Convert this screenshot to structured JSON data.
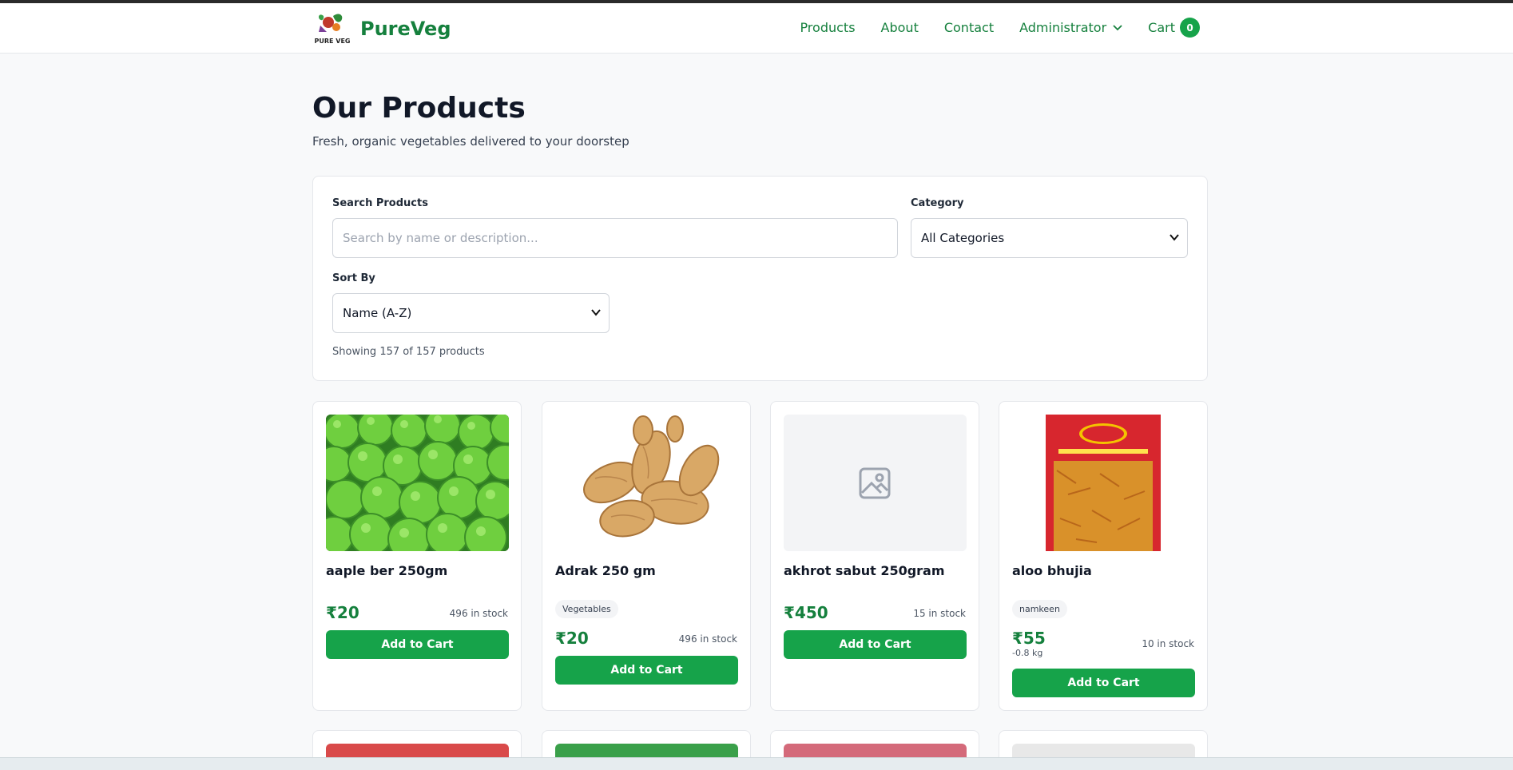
{
  "brand": {
    "name": "PureVeg",
    "logo_text": "PURE VEG"
  },
  "nav": {
    "products": "Products",
    "about": "About",
    "contact": "Contact",
    "administrator": "Administrator",
    "cart": "Cart",
    "cart_count": "0"
  },
  "page": {
    "title": "Our Products",
    "subtitle": "Fresh, organic vegetables delivered to your doorstep"
  },
  "filters": {
    "search_label": "Search Products",
    "search_placeholder": "Search by name or description...",
    "category_label": "Category",
    "category_value": "All Categories",
    "sort_label": "Sort By",
    "sort_value": "Name (A-Z)",
    "showing": "Showing 157 of 157 products"
  },
  "products": [
    {
      "name": "aaple ber 250gm",
      "price": "₹20",
      "stock": "496 in stock",
      "button": "Add to Cart",
      "image": "green-ber-fruits"
    },
    {
      "name": "Adrak 250 gm",
      "category": "Vegetables",
      "price": "₹20",
      "stock": "496 in stock",
      "button": "Add to Cart",
      "image": "ginger-root"
    },
    {
      "name": "akhrot sabut 250gram",
      "price": "₹450",
      "stock": "15 in stock",
      "button": "Add to Cart",
      "image": "image-placeholder-icon"
    },
    {
      "name": "aloo bhujia",
      "category": "namkeen",
      "price": "₹55",
      "note": "-0.8 kg",
      "stock": "10 in stock",
      "button": "Add to Cart",
      "image": "aloo-bhujia-packet"
    }
  ],
  "colors": {
    "brand_green": "#15803d",
    "button_green": "#16a34a",
    "background": "#f8f9fa"
  }
}
